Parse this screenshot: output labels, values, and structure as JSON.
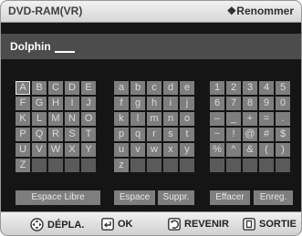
{
  "header": {
    "title": "DVD-RAM(VR)",
    "rename": "❖Renommer"
  },
  "input": {
    "value": "Dolphin"
  },
  "keys": {
    "upper": [
      [
        "A",
        "B",
        "C",
        "D",
        "E"
      ],
      [
        "F",
        "G",
        "H",
        "I",
        "J"
      ],
      [
        "K",
        "L",
        "M",
        "N",
        "O"
      ],
      [
        "P",
        "Q",
        "R",
        "S",
        "T"
      ],
      [
        "U",
        "V",
        "W",
        "X",
        "Y"
      ],
      [
        "Z",
        "",
        "",
        "",
        ""
      ]
    ],
    "lower": [
      [
        "a",
        "b",
        "c",
        "d",
        "e"
      ],
      [
        "f",
        "g",
        "h",
        "i",
        "j"
      ],
      [
        "k",
        "l",
        "m",
        "n",
        "o"
      ],
      [
        "p",
        "q",
        "r",
        "s",
        "t"
      ],
      [
        "u",
        "v",
        "w",
        "x",
        "y"
      ],
      [
        "z",
        "",
        "",
        "",
        ""
      ]
    ],
    "symbols": [
      [
        "1",
        "2",
        "3",
        "4",
        "5"
      ],
      [
        "6",
        "7",
        "8",
        "9",
        "0"
      ],
      [
        "–",
        "_",
        "+",
        "=",
        "."
      ],
      [
        "~",
        "!",
        "@",
        "#",
        "$"
      ],
      [
        "%",
        "^",
        "&",
        "(",
        ")"
      ],
      [
        "",
        "",
        "",
        "",
        ""
      ]
    ],
    "selected": "A"
  },
  "actions": {
    "space_free": "Espace Libre",
    "space": "Espace",
    "delete": "Suppr.",
    "clear": "Effacer",
    "save": "Enreg."
  },
  "footer": {
    "move": "DÉPLA.",
    "ok": "OK",
    "back": "REVENIR",
    "exit": "SORTIE"
  }
}
